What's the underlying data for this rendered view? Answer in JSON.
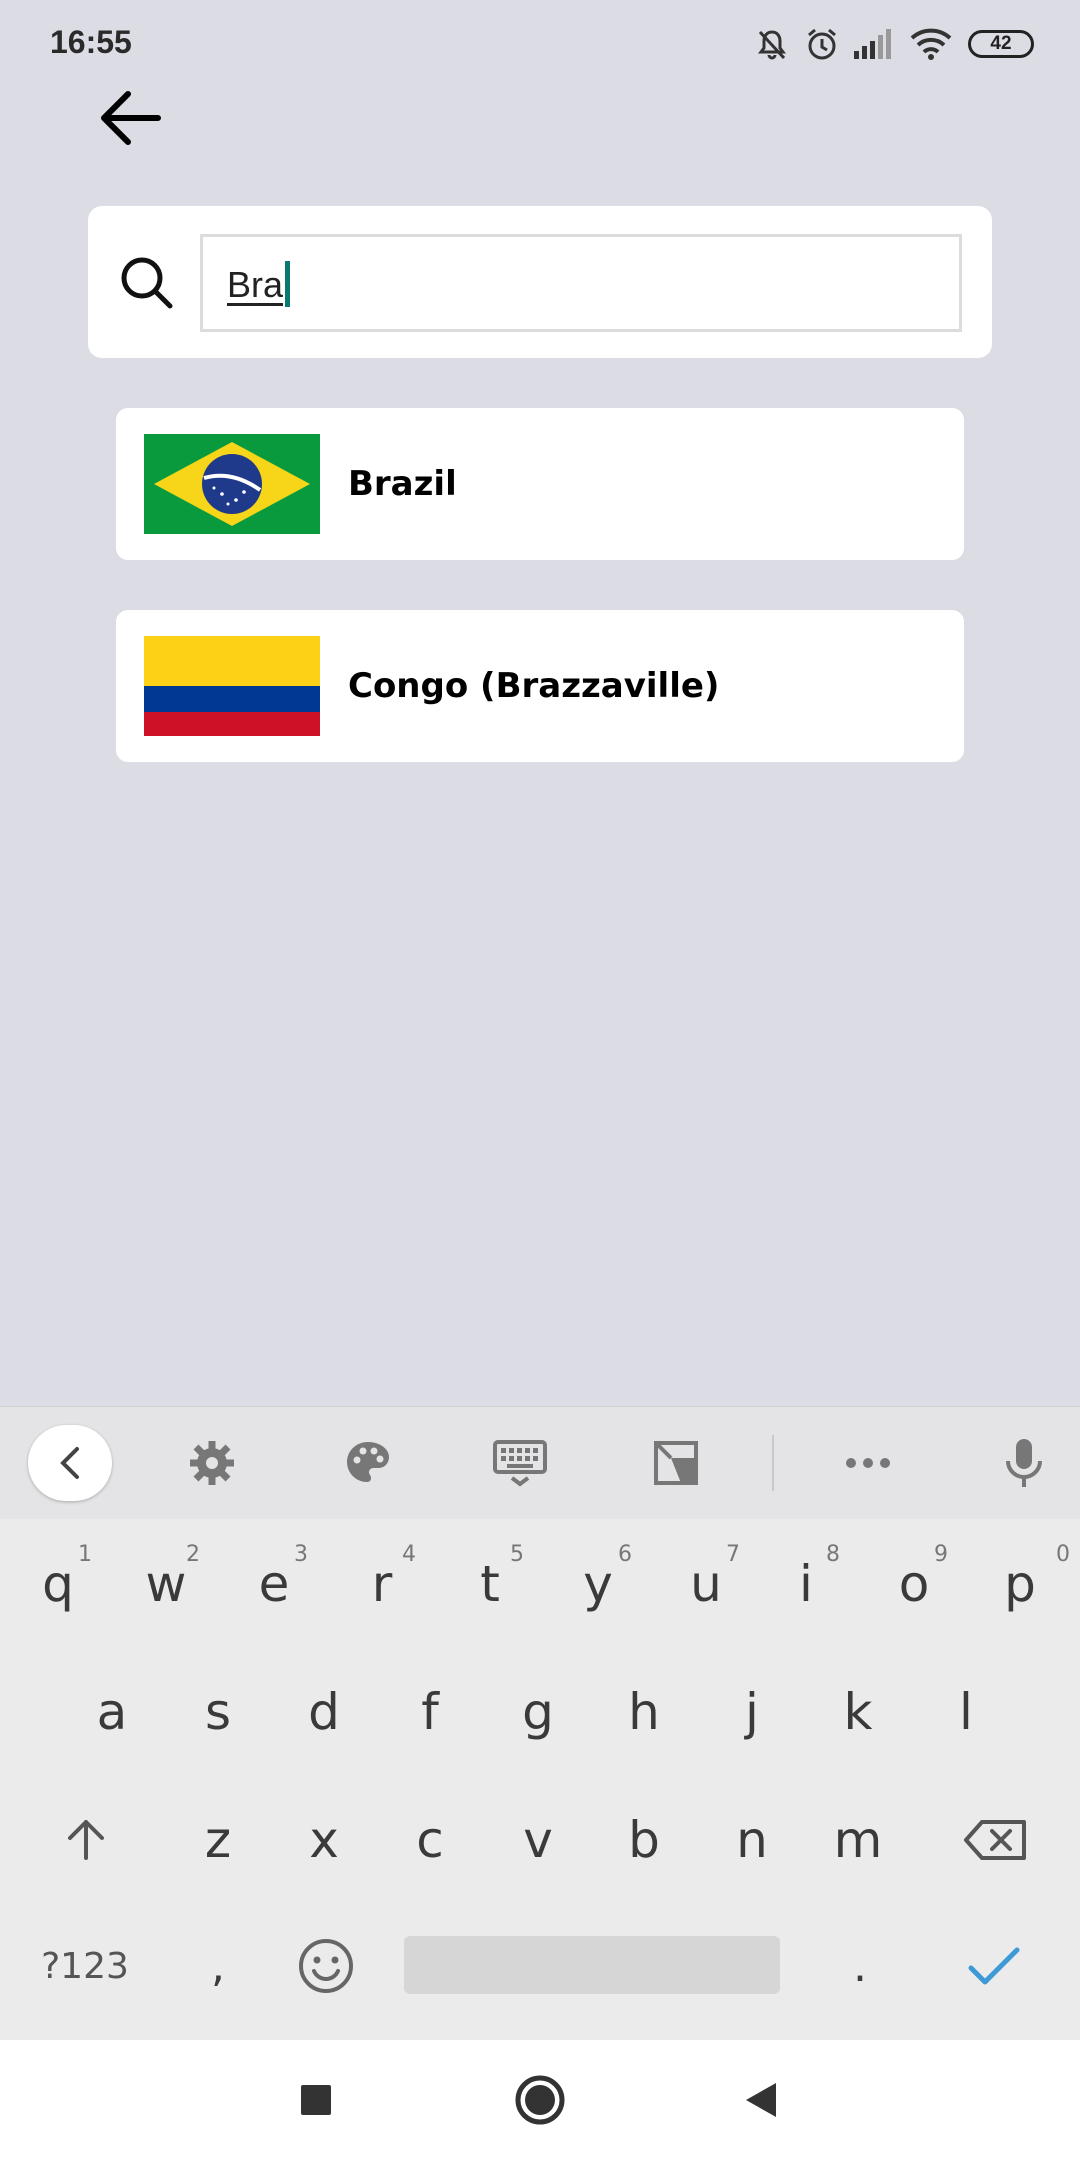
{
  "status_bar": {
    "time": "16:55",
    "battery": "42",
    "icons": [
      "mute-icon",
      "alarm-icon",
      "signal-icon",
      "wifi-icon",
      "battery-icon"
    ]
  },
  "search": {
    "value": "Bra"
  },
  "results": [
    {
      "label": "Brazil",
      "flag": "brazil-flag"
    },
    {
      "label": "Congo (Brazzaville)",
      "flag": "colombia-style-flag"
    }
  ],
  "keyboard": {
    "toolbar": [
      "collapse-icon",
      "settings-icon",
      "palette-icon",
      "keyboard-layout-icon",
      "clipboard-icon",
      "more-icon",
      "mic-icon"
    ],
    "row1": [
      {
        "key": "q",
        "hint": "1"
      },
      {
        "key": "w",
        "hint": "2"
      },
      {
        "key": "e",
        "hint": "3"
      },
      {
        "key": "r",
        "hint": "4"
      },
      {
        "key": "t",
        "hint": "5"
      },
      {
        "key": "y",
        "hint": "6"
      },
      {
        "key": "u",
        "hint": "7"
      },
      {
        "key": "i",
        "hint": "8"
      },
      {
        "key": "o",
        "hint": "9"
      },
      {
        "key": "p",
        "hint": "0"
      }
    ],
    "row2": [
      "a",
      "s",
      "d",
      "f",
      "g",
      "h",
      "j",
      "k",
      "l"
    ],
    "row3": [
      "z",
      "x",
      "c",
      "v",
      "b",
      "n",
      "m"
    ],
    "row4": {
      "symbols": "?123",
      "comma": ",",
      "period": "."
    }
  },
  "colors": {
    "background": "#dcdce5",
    "caret": "#0a7a6e",
    "enter_check": "#3d9ad6"
  }
}
